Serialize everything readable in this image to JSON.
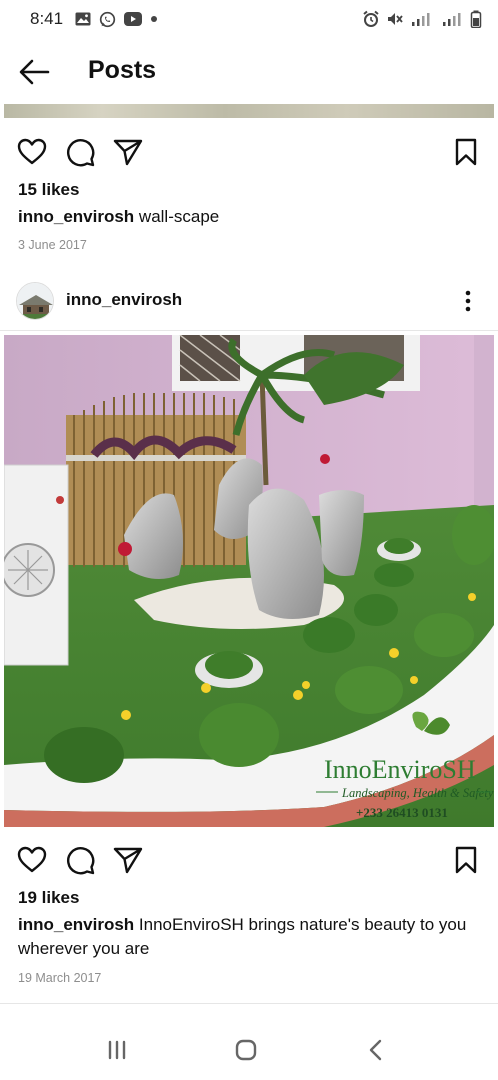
{
  "status_bar": {
    "time": "8:41",
    "left_icons": [
      "gallery-icon",
      "whatsapp-icon",
      "youtube-icon",
      "dot-icon"
    ],
    "right_icons": [
      "alarm-icon",
      "mute-icon",
      "signal-icon",
      "signal-icon",
      "battery-icon"
    ]
  },
  "header": {
    "title": "Posts",
    "back_icon": "arrow-left-icon"
  },
  "post1": {
    "likes": "15 likes",
    "username": "inno_envirosh",
    "caption": "wall-scape",
    "date": "3 June 2017"
  },
  "post2": {
    "username": "inno_envirosh",
    "likes": "19 likes",
    "caption": "InnoEnviroSH brings nature's beauty to you wherever you are",
    "date": "19 March 2017",
    "watermark": {
      "brand": "InnoEnviroSH",
      "tagline": "Landscaping, Health & Safety",
      "phone": "+233 26413 0131"
    }
  },
  "nav": {
    "items": [
      "recents-icon",
      "home-icon",
      "back-icon"
    ]
  },
  "colors": {
    "text": "#111111",
    "secondary": "#8e8e8e",
    "divider": "#e6e6e6",
    "brand_green": "#2e7d32"
  }
}
